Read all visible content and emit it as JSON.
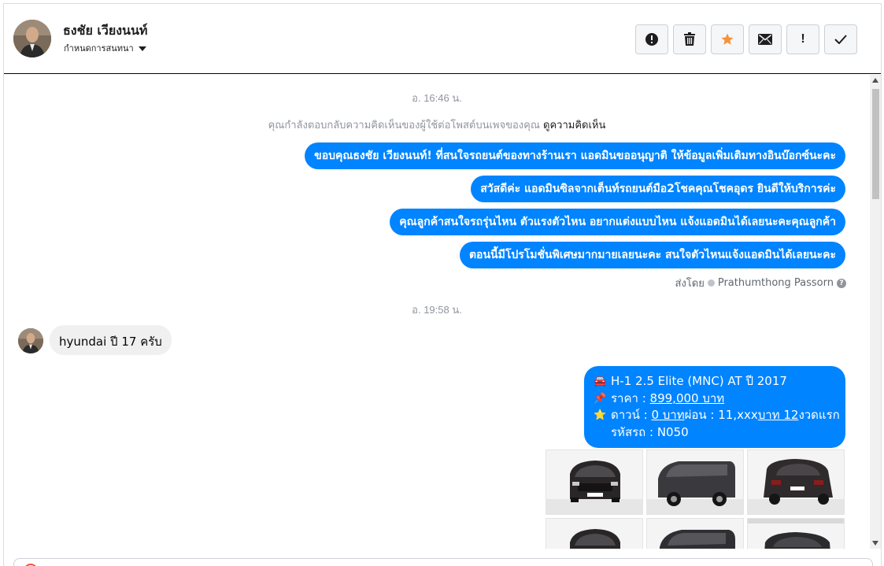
{
  "header": {
    "contact_name": "ธงชัย เวียงนนท์",
    "assign_label": "กำหนดการสนทนา",
    "actions": [
      {
        "name": "spam-button",
        "icon": "alert-circle-icon"
      },
      {
        "name": "delete-button",
        "icon": "trash-icon"
      },
      {
        "name": "star-button",
        "icon": "star-icon",
        "color": "#f7923a"
      },
      {
        "name": "mark-unread-button",
        "icon": "envelope-icon"
      },
      {
        "name": "follow-up-button",
        "icon": "exclamation-icon",
        "text": "!"
      },
      {
        "name": "done-button",
        "icon": "check-icon"
      }
    ]
  },
  "thread": {
    "timestamp_1": "อ. 16:46 น.",
    "notice_text": "คุณกำลังตอบกลับความคิดเห็นของผู้ใช้ต่อโพสต์บนเพจของคุณ",
    "notice_link": "ดูความคิดเห็น",
    "outgoing": [
      "ขอบคุณธงชัย เวียงนนท์! ที่สนใจรถยนต์ของทางร้านเรา แอดมินขออนุญาติ ให้ข้อมูลเพิ่มเติมทางอินบ๊อกซ์นะคะ",
      "สวัสดีค่ะ แอดมินซิลจากเต็นท์รถยนต์มือ2โชคคุณโชคอุดร ยินดีให้บริการค่ะ",
      "คุณลูกค้าสนใจรถรุ่นไหน ตัวแรงตัวไหน อยากแต่งแบบไหน แจ้งแอดมินได้เลยนะคะคุณลูกค้า",
      "ตอนนี้มีโปรโมชั่นพิเศษมากมายเลยนะคะ สนใจตัวไหนแจ้งแอดมินได้เลยนะคะ"
    ],
    "sent_by_label": "ส่งโดย",
    "sent_by_name": "Prathumthong Passorn",
    "timestamp_2": "อ. 19:58 น.",
    "incoming": "hyundai ปี 17 ครับ",
    "card": {
      "line1": "H-1 2.5 Elite (MNC) AT ปี 2017",
      "price_label": "ราคา : ",
      "price_value": "899,000 บาท",
      "down_label": "ดาวน์ : ",
      "down_value": "0 บาท",
      "installment_label": " ผ่อน : 11,xxx",
      "installment_value": "บาท 12",
      "installment_suffix": " งวดแรก",
      "code_line": "รหัสรถ : N050",
      "emoji": [
        "🚘",
        "📌",
        "⭐"
      ]
    },
    "photos": [
      "van-front-photo",
      "van-side-photo",
      "van-rear-photo",
      "van-photo-4",
      "van-photo-5",
      "van-photo-6"
    ]
  },
  "colors": {
    "accent": "#0084ff",
    "incoming_bubble": "#f1f0f0",
    "star": "#f7923a"
  }
}
